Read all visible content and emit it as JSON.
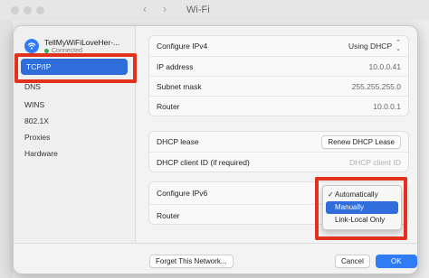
{
  "window": {
    "title": "Wi-Fi"
  },
  "network": {
    "name": "TellMyWiFiLoveHer-...",
    "status": "Connected"
  },
  "sidebar": {
    "items": [
      {
        "label": "TCP/IP"
      },
      {
        "label": "DNS"
      },
      {
        "label": "WINS"
      },
      {
        "label": "802.1X"
      },
      {
        "label": "Proxies"
      },
      {
        "label": "Hardware"
      }
    ]
  },
  "ipv4": {
    "configure_label": "Configure IPv4",
    "configure_value": "Using DHCP",
    "ip_label": "IP address",
    "ip_value": "10.0.0.41",
    "subnet_label": "Subnet mask",
    "subnet_value": "255.255.255.0",
    "router_label": "Router",
    "router_value": "10.0.0.1"
  },
  "dhcp": {
    "lease_label": "DHCP lease",
    "renew_button": "Renew DHCP Lease",
    "client_id_label": "DHCP client ID (if required)",
    "client_id_placeholder": "DHCP client ID"
  },
  "ipv6": {
    "configure_label": "Configure IPv6",
    "router_label": "Router"
  },
  "menu": {
    "items": [
      {
        "label": "Automatically",
        "checked": true
      },
      {
        "label": "Manually",
        "highlighted": true
      },
      {
        "label": "Link-Local Only"
      }
    ]
  },
  "footer": {
    "forget_button": "Forget This Network...",
    "cancel_button": "Cancel",
    "ok_button": "OK"
  },
  "colors": {
    "accent": "#2f6ddb",
    "highlight_frame": "#e0321c",
    "status_dot": "#2bb34a"
  }
}
